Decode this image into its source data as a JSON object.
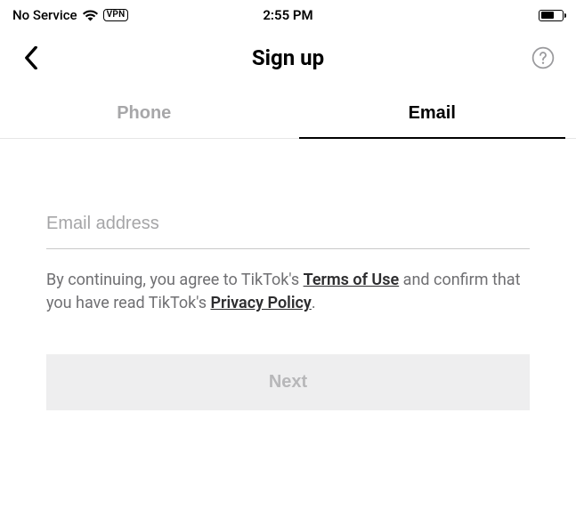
{
  "status_bar": {
    "carrier": "No Service",
    "vpn_label": "VPN",
    "time": "2:55 PM"
  },
  "nav": {
    "title": "Sign up"
  },
  "tabs": {
    "phone": "Phone",
    "email": "Email",
    "active": "email"
  },
  "form": {
    "email_placeholder": "Email address",
    "email_value": ""
  },
  "consent": {
    "prefix": "By continuing, you agree to TikTok's ",
    "terms_label": "Terms of Use",
    "middle": " and confirm that you have read TikTok's ",
    "privacy_label": "Privacy Policy",
    "suffix": "."
  },
  "actions": {
    "next_label": "Next"
  }
}
